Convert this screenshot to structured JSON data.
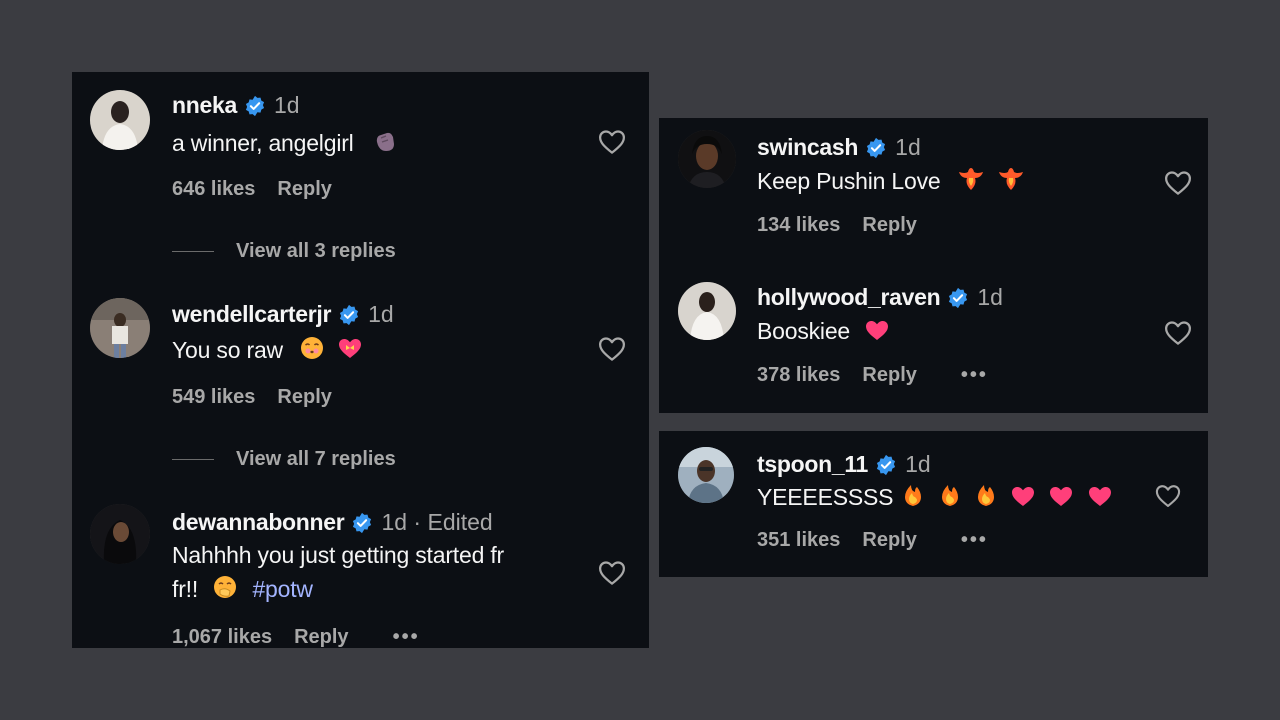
{
  "colors": {
    "background": "#3b3c41",
    "panel": "#0c0f14",
    "verified": "#3897f0",
    "muted": "#a8a8a8",
    "hashtag": "#a3b4ff",
    "heart_pink": "#ff3f7a",
    "fire": "#ff7a1a"
  },
  "left_panel": {
    "comments": [
      {
        "username": "nneka",
        "time": "1d",
        "text": "a winner, angelgirl",
        "emojis": [
          "clapping-hands"
        ],
        "likes": "646 likes",
        "reply": "Reply",
        "view_replies": "View all 3 replies"
      },
      {
        "username": "wendellcarterjr",
        "time": "1d",
        "text": "You so raw",
        "emojis": [
          "kissing-face",
          "heart-with-ribbon"
        ],
        "likes": "549 likes",
        "reply": "Reply",
        "view_replies": "View all 7 replies"
      },
      {
        "username": "dewannabonner",
        "time": "1d · Edited",
        "text_line1": "Nahhhh you just getting started fr",
        "text_line2": "fr!!",
        "emojis": [
          "hand-over-mouth-face"
        ],
        "hashtag": "#potw",
        "likes": "1,067 likes",
        "reply": "Reply",
        "more": "•••"
      }
    ]
  },
  "right_panel_top": {
    "comments": [
      {
        "username": "swincash",
        "time": "1d",
        "text": "Keep Pushin Love",
        "emojis": [
          "phoenix",
          "phoenix"
        ],
        "likes": "134 likes",
        "reply": "Reply"
      },
      {
        "username": "hollywood_raven",
        "time": "1d",
        "text": "Booskiee",
        "emojis": [
          "pink-heart"
        ],
        "likes": "378 likes",
        "reply": "Reply",
        "more": "•••"
      }
    ]
  },
  "right_panel_bottom": {
    "comments": [
      {
        "username": "tspoon_11",
        "time": "1d",
        "text": "YEEEESSSS",
        "emojis": [
          "fire",
          "fire",
          "fire",
          "pink-heart",
          "pink-heart",
          "pink-heart"
        ],
        "likes": "351 likes",
        "reply": "Reply",
        "more": "•••"
      }
    ]
  }
}
